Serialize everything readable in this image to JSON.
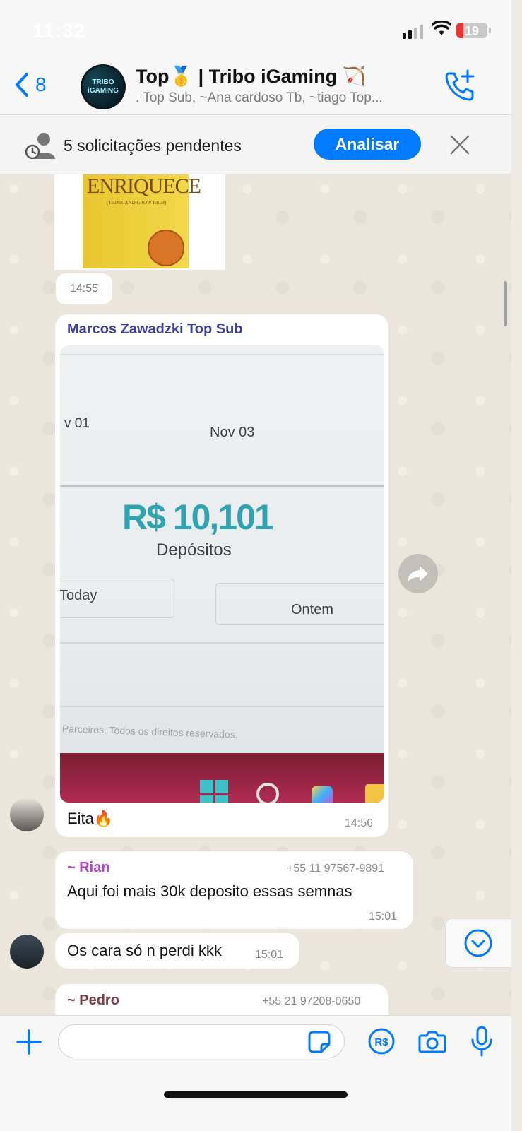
{
  "status_bar": {
    "time": "11:32",
    "battery": "19"
  },
  "header": {
    "back_count": "8",
    "avatar_text": "TRIBO iGAMING",
    "title": "Top🥇 | Tribo iGaming 🏹",
    "subtitle": ". Top Sub, ~Ana cardoso Tb, ~tiago Top..."
  },
  "banner": {
    "text": "5 solicitações pendentes",
    "button": "Analisar"
  },
  "book": {
    "title": "ENRIQUECE",
    "subtitle": "(THINK AND GROW RICH)"
  },
  "messages": [
    {
      "time": "14:55"
    },
    {
      "sender": "Marcos Zawadzki Top Sub",
      "photo": {
        "left_date": "v 01",
        "right_date": "Nov 03",
        "amount": "R$ 10,101",
        "amount_label": "Depósitos",
        "today": "Today",
        "yesterday": "Ontem",
        "footer": "Bet Parceiros. Todos os direitos reservados."
      },
      "text": "Eita🔥",
      "time": "14:56"
    },
    {
      "sender": "~ Rian",
      "phone": "+55 11 97567-9891",
      "text": "Aqui foi mais 30k deposito essas semnas",
      "time": "15:01"
    },
    {
      "text": "Os cara só n perdi kkk",
      "time": "15:01"
    },
    {
      "sender": "~ Pedro",
      "phone": "+55 21 97208-0650"
    }
  ],
  "colors": {
    "accent": "#007aff",
    "marcos": "#3b3f9e",
    "rian": "#b545c9",
    "pedro": "#7a3b4a"
  }
}
